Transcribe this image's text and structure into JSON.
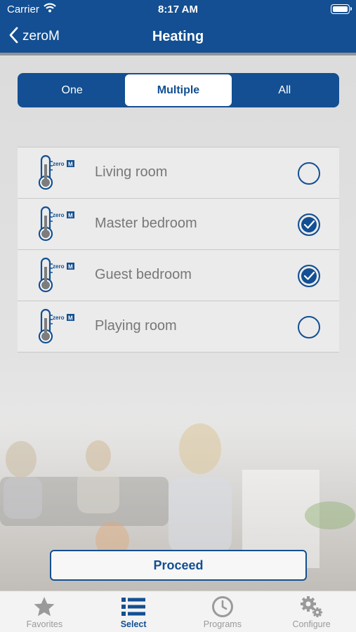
{
  "status_bar": {
    "carrier": "Carrier",
    "time": "8:17 AM"
  },
  "nav": {
    "back_label": "zeroM",
    "title": "Heating"
  },
  "segments": [
    {
      "label": "One",
      "active": false
    },
    {
      "label": "Multiple",
      "active": true
    },
    {
      "label": "All",
      "active": false
    }
  ],
  "rooms": [
    {
      "name": "Living room",
      "checked": false,
      "icon": "thermometer-icon",
      "logo": "zero M"
    },
    {
      "name": "Master bedroom",
      "checked": true,
      "icon": "thermometer-icon",
      "logo": "zero M"
    },
    {
      "name": "Guest bedroom",
      "checked": true,
      "icon": "thermometer-icon",
      "logo": "zero M"
    },
    {
      "name": "Playing room",
      "checked": false,
      "icon": "thermometer-icon",
      "logo": "zero M"
    }
  ],
  "proceed_label": "Proceed",
  "tabs": [
    {
      "label": "Favorites",
      "icon": "star-icon",
      "active": false
    },
    {
      "label": "Select",
      "icon": "list-icon",
      "active": true
    },
    {
      "label": "Programs",
      "icon": "clock-icon",
      "active": false
    },
    {
      "label": "Configure",
      "icon": "gears-icon",
      "active": false
    }
  ],
  "colors": {
    "brand": "#134f92",
    "inactive": "#9a9a9a",
    "row_bg": "#ebebeb"
  }
}
